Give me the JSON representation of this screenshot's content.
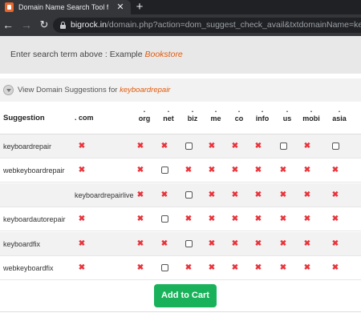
{
  "browser": {
    "tab_title": "Domain Name Search Tool for Gr",
    "tab_close": "✕",
    "new_tab": "+",
    "url_host": "bigrock.in",
    "url_path": "/domain.php?action=dom_suggest_check_avail&txtdomainName=keyboardre..."
  },
  "search_hint": {
    "prefix": "Enter search term above : Example ",
    "example": "Bookstore"
  },
  "suggestions_header": {
    "label": "View Domain Suggestions for ",
    "keyword": "keyboardrepair"
  },
  "table": {
    "col_suggestion": "Suggestion",
    "col_com": ". com",
    "tlds": [
      ".",
      ".",
      ".",
      ".",
      ".",
      ".",
      ".",
      ".",
      "."
    ],
    "tld_names": [
      "org",
      "net",
      "biz",
      "me",
      "co",
      "info",
      "us",
      "mobi",
      "asia"
    ],
    "rows": [
      {
        "name": "keyboardrepair",
        "com": "x",
        "cells": [
          "x",
          "x",
          "c",
          "x",
          "x",
          "x",
          "c",
          "x",
          "c"
        ]
      },
      {
        "name": "webkeyboardrepair",
        "com": "x",
        "cells": [
          "x",
          "c",
          "x",
          "x",
          "x",
          "x",
          "x",
          "x",
          "x"
        ]
      },
      {
        "name": "",
        "com_text": "keyboardrepairlive",
        "cells": [
          "x",
          "x",
          "c",
          "x",
          "x",
          "x",
          "x",
          "x",
          "x"
        ]
      },
      {
        "name": "keyboardautorepair",
        "com": "x",
        "cells": [
          "x",
          "c",
          "x",
          "x",
          "x",
          "x",
          "x",
          "x",
          "x"
        ]
      },
      {
        "name": "keyboardfix",
        "com": "x",
        "cells": [
          "x",
          "x",
          "c",
          "x",
          "x",
          "x",
          "x",
          "x",
          "x"
        ]
      },
      {
        "name": "webkeyboardfix",
        "com": "x",
        "cells": [
          "x",
          "c",
          "x",
          "x",
          "x",
          "x",
          "x",
          "x",
          "x"
        ]
      }
    ]
  },
  "add_to_cart": "Add to Cart",
  "icons": {
    "unavailable": "close-icon",
    "available": "checkbox"
  },
  "colors": {
    "unavailable": "#e8343b",
    "accent": "#e05a0c",
    "cart_button": "#19b25a"
  }
}
